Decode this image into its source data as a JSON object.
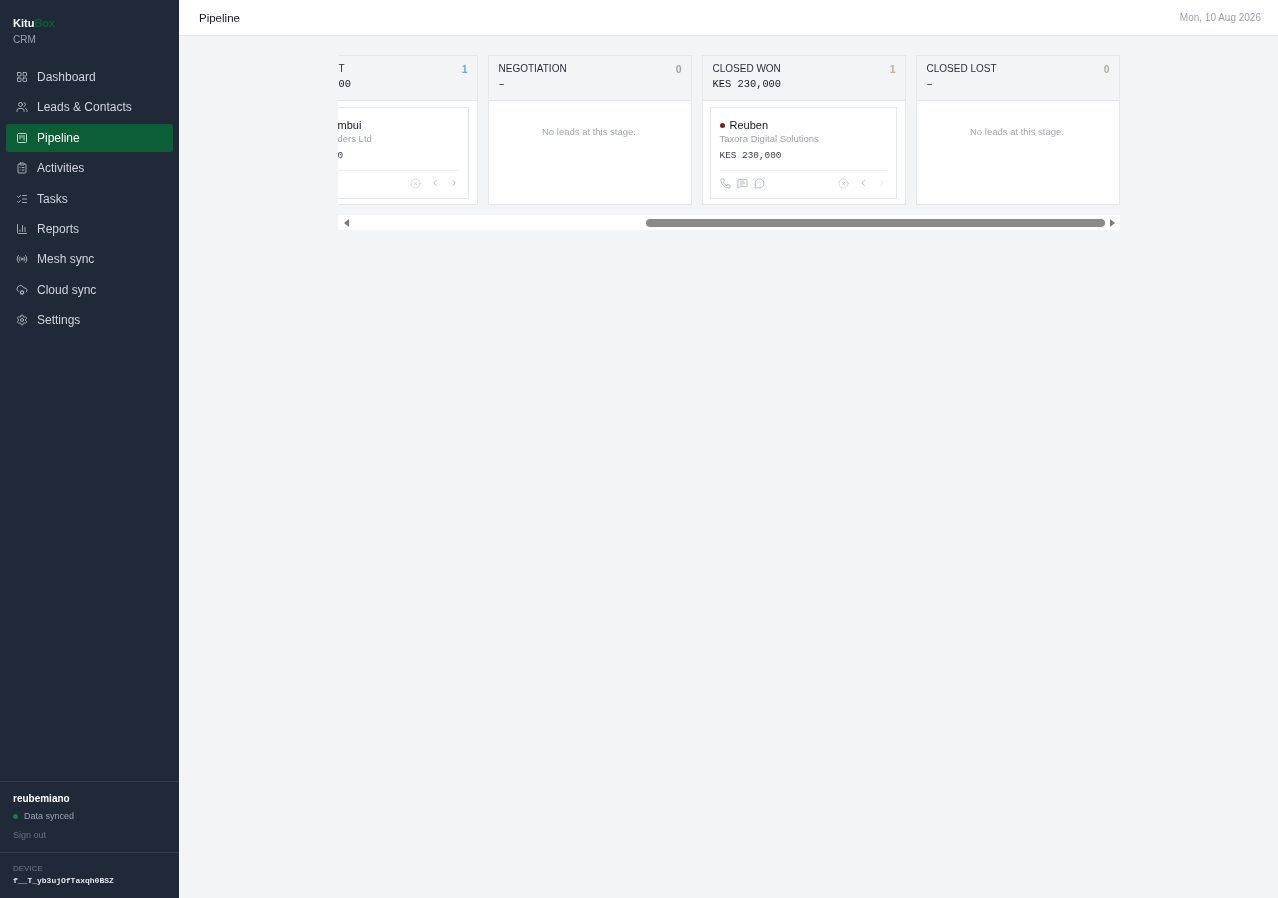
{
  "sidebar": {
    "brand": {
      "name": "Kitu",
      "accent": "Box",
      "subtitle": "CRM"
    },
    "nav": [
      {
        "label": "Dashboard",
        "selected": false
      },
      {
        "label": "Leads & Contacts",
        "selected": false
      },
      {
        "label": "Pipeline",
        "selected": true
      },
      {
        "label": "Activities",
        "selected": false
      },
      {
        "label": "Tasks",
        "selected": false
      },
      {
        "label": "Reports",
        "selected": false
      },
      {
        "label": "Mesh sync",
        "selected": false
      },
      {
        "label": "Cloud sync",
        "selected": false
      },
      {
        "label": "Settings",
        "selected": false
      }
    ],
    "user": {
      "name": "reubemiano",
      "status": "Data synced",
      "synced": true,
      "sign_out": "Sign out"
    },
    "device": {
      "label": "DEVICE",
      "id": "f__T_yb3ujOfTaxqh0BSZ"
    }
  },
  "header": {
    "title": "Pipeline",
    "date": "Mon, 10 Aug 2026"
  },
  "board": {
    "columns": [
      {
        "kind": "partial",
        "title": "T",
        "amount": "00",
        "count": "1",
        "color": "#60a5fa",
        "cards": [
          {
            "name": "mbui",
            "company": "ders Ltd",
            "amount": "0",
            "next_disabled": false
          }
        ]
      },
      {
        "kind": "full",
        "title": "NEGOTIATION",
        "amount": "–",
        "count": "0",
        "color": "#9ca3af",
        "empty_text": "No leads at this stage."
      },
      {
        "kind": "full",
        "title": "CLOSED WON",
        "amount": "KES 230,000",
        "count": "1",
        "color": "#c9b27c",
        "cards": [
          {
            "name": "Reuben",
            "company": "Taxora Digital Solutions",
            "amount": "KES 230,000",
            "color": "#7f1d1d",
            "next_disabled": true
          }
        ]
      },
      {
        "kind": "full",
        "title": "CLOSED LOST",
        "amount": "–",
        "count": "0",
        "color": "#a3b89b",
        "empty_text": "No leads at this stage."
      }
    ]
  }
}
